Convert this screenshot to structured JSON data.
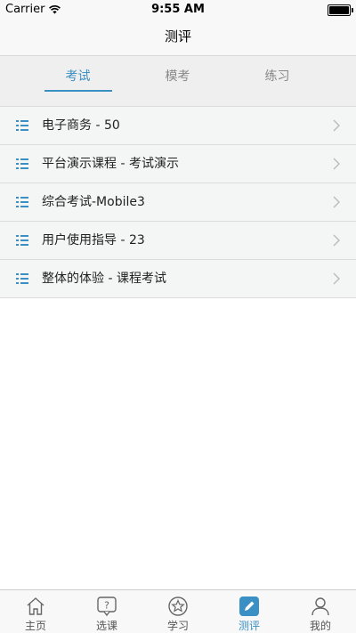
{
  "status_bar": {
    "carrier": "Carrier",
    "time": "9:55 AM"
  },
  "nav": {
    "title": "测评"
  },
  "segments": [
    {
      "label": "考试",
      "active": true
    },
    {
      "label": "模考",
      "active": false
    },
    {
      "label": "练习",
      "active": false
    }
  ],
  "list": [
    {
      "label": "电子商务 - 50"
    },
    {
      "label": "平台演示课程 - 考试演示"
    },
    {
      "label": "综合考试-Mobile3"
    },
    {
      "label": "用户使用指导 - 23"
    },
    {
      "label": "整体的体验 - 课程考试"
    }
  ],
  "tabbar": [
    {
      "label": "主页",
      "icon": "home-icon",
      "active": false
    },
    {
      "label": "选课",
      "icon": "question-bubble-icon",
      "active": false
    },
    {
      "label": "学习",
      "icon": "star-icon",
      "active": false
    },
    {
      "label": "测评",
      "icon": "edit-icon",
      "active": true
    },
    {
      "label": "我的",
      "icon": "user-icon",
      "active": false
    }
  ],
  "colors": {
    "accent": "#3a8fc4",
    "list_bg": "#f4f5f5",
    "segment_bg": "#efefef"
  }
}
